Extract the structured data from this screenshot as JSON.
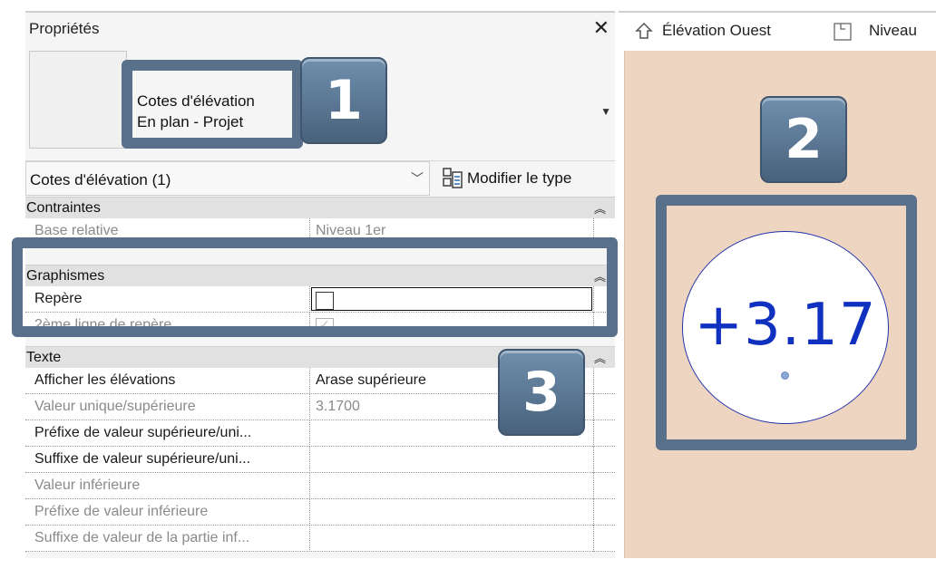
{
  "properties": {
    "title": "Propriétés",
    "close_glyph": "✕",
    "type_selector": {
      "line1": "Cotes d'élévation",
      "line2": "En plan - Projet"
    },
    "instance_selector": "Cotes d'élévation (1)",
    "edit_type_label": "Modifier le type",
    "categories": {
      "constraints": "Contraintes",
      "graphics": "Graphismes",
      "text": "Texte"
    },
    "rows": {
      "base_relative": {
        "name": "Base relative",
        "value": "Niveau 1er"
      },
      "repere": {
        "name": "Repère",
        "checked": false
      },
      "second_leader": {
        "name": "2ème ligne de repère",
        "checked": true
      },
      "show_elevations": {
        "name": "Afficher les élévations",
        "value": "Arase supérieure"
      },
      "single_upper_value": {
        "name": "Valeur unique/supérieure",
        "value": "3.1700"
      },
      "upper_prefix": {
        "name": "Préfixe de valeur supérieure/uni...",
        "value": ""
      },
      "upper_suffix": {
        "name": "Suffixe de valeur supérieure/uni...",
        "value": ""
      },
      "lower_value": {
        "name": "Valeur inférieure",
        "value": ""
      },
      "lower_prefix": {
        "name": "Préfixe de valeur inférieure",
        "value": ""
      },
      "lower_suffix": {
        "name": "Suffixe de valeur de la partie inf...",
        "value": ""
      }
    }
  },
  "view_tabs": {
    "tab1": "Élévation Ouest",
    "tab2": "Niveau"
  },
  "elevation_tag": {
    "value": "+3.17"
  },
  "callouts": {
    "one": "1",
    "two": "2",
    "three": "3"
  },
  "colors": {
    "callout": "#58708a",
    "tag_text": "#1030c0",
    "view_background": "#edd5c2"
  }
}
